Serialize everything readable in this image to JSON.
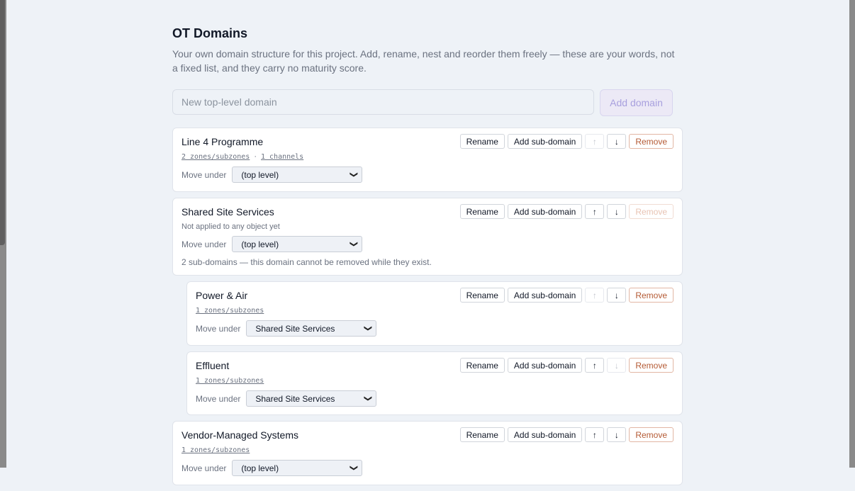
{
  "header": {
    "title": "OT Domains",
    "description": "Your own domain structure for this project. Add, rename, nest and reorder them freely — these are your words, not a fixed list, and they carry no maturity score."
  },
  "new_domain": {
    "placeholder": "New top-level domain",
    "add_label": "Add domain"
  },
  "labels": {
    "rename": "Rename",
    "add_sub": "Add sub-domain",
    "remove": "Remove",
    "move_under": "Move under",
    "up": "↑",
    "down": "↓"
  },
  "domains": [
    {
      "name": "Line 4 Programme",
      "zones": "2 zones/subzones",
      "sep": "·",
      "channels": "1 channels",
      "parent": "(top level)"
    },
    {
      "name": "Shared Site Services",
      "status": "Not applied to any object yet",
      "parent": "(top level)",
      "note": "2 sub-domains — this domain cannot be removed while they exist."
    },
    {
      "name": "Power & Air",
      "zones": "1 zones/subzones",
      "parent": "Shared Site Services"
    },
    {
      "name": "Effluent",
      "zones": "1 zones/subzones",
      "parent": "Shared Site Services"
    },
    {
      "name": "Vendor-Managed Systems",
      "zones": "1 zones/subzones",
      "parent": "(top level)"
    }
  ]
}
